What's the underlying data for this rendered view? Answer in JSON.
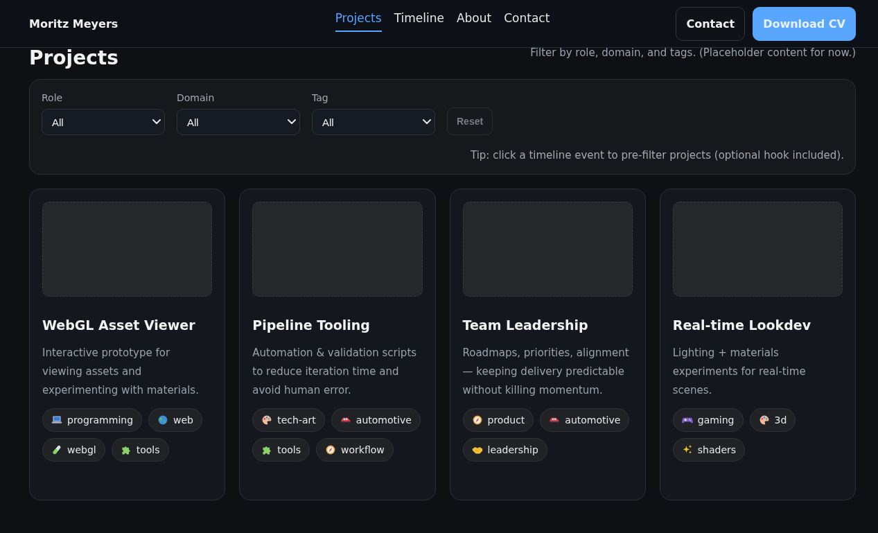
{
  "header": {
    "brand": "Moritz Meyers",
    "nav": [
      {
        "label": "Projects",
        "selected": true
      },
      {
        "label": "Timeline",
        "selected": false
      },
      {
        "label": "About",
        "selected": false
      },
      {
        "label": "Contact",
        "selected": false
      }
    ],
    "actions": [
      {
        "label": "Contact",
        "kind": "secondary"
      },
      {
        "label": "Download CV",
        "kind": "primary"
      }
    ]
  },
  "page": {
    "title": "Projects",
    "subtitle": "Filter by role, domain, and tags. (Placeholder content for now.)"
  },
  "filters": {
    "fields": [
      {
        "label": "Role",
        "value": "All"
      },
      {
        "label": "Domain",
        "value": "All"
      },
      {
        "label": "Tag",
        "value": "All"
      }
    ],
    "reset": {
      "label": "Reset",
      "disabled": true
    },
    "tip": "Tip: click a timeline event to pre-filter projects (optional hook included)."
  },
  "projects": [
    {
      "title": "WebGL Asset Viewer",
      "description": "Interactive prototype for viewing assets and experimenting with materials.",
      "tags": [
        {
          "label": "programming",
          "kind": "laptop"
        },
        {
          "label": "web",
          "kind": "globe"
        },
        {
          "label": "webgl",
          "kind": "tube"
        },
        {
          "label": "tools",
          "kind": "puzzle"
        }
      ]
    },
    {
      "title": "Pipeline Tooling",
      "description": "Automation & validation scripts to reduce iteration time and avoid human error.",
      "tags": [
        {
          "label": "tech-art",
          "kind": "palette"
        },
        {
          "label": "automotive",
          "kind": "car"
        },
        {
          "label": "tools",
          "kind": "puzzle"
        },
        {
          "label": "workflow",
          "kind": "compass"
        }
      ]
    },
    {
      "title": "Team Leadership",
      "description": "Roadmaps, priorities, alignment — keeping delivery predictable without killing momentum.",
      "tags": [
        {
          "label": "product",
          "kind": "compass"
        },
        {
          "label": "automotive",
          "kind": "car"
        },
        {
          "label": "leadership",
          "kind": "handshake"
        }
      ]
    },
    {
      "title": "Real-time Lookdev",
      "description": "Lighting + materials experiments for real-time scenes.",
      "tags": [
        {
          "label": "gaming",
          "kind": "gamepad"
        },
        {
          "label": "3d",
          "kind": "palette"
        },
        {
          "label": "shaders",
          "kind": "sparkles"
        }
      ]
    }
  ]
}
